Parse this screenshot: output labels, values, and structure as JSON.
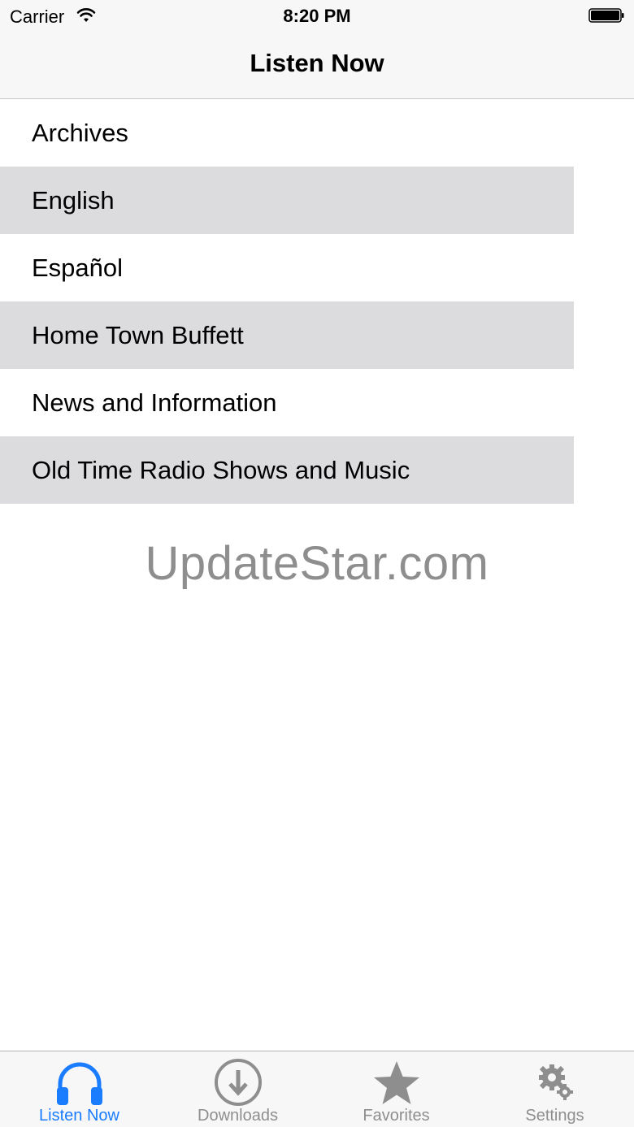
{
  "status_bar": {
    "carrier": "Carrier",
    "time": "8:20 PM"
  },
  "nav": {
    "title": "Listen Now"
  },
  "list": {
    "items": [
      {
        "label": "Archives"
      },
      {
        "label": "English"
      },
      {
        "label": "Español"
      },
      {
        "label": "Home Town Buffett"
      },
      {
        "label": "News and Information"
      },
      {
        "label": "Old Time Radio Shows and Music"
      }
    ]
  },
  "watermark": "UpdateStar.com",
  "tabs": [
    {
      "label": "Listen Now",
      "icon": "headphones-icon",
      "active": true
    },
    {
      "label": "Downloads",
      "icon": "download-icon",
      "active": false
    },
    {
      "label": "Favorites",
      "icon": "star-icon",
      "active": false
    },
    {
      "label": "Settings",
      "icon": "gear-icon",
      "active": false
    }
  ],
  "colors": {
    "accent": "#1a7cff",
    "inactive": "#8e8e8e",
    "row_alt": "#dcdcdf",
    "bar_bg": "#f7f7f7"
  }
}
